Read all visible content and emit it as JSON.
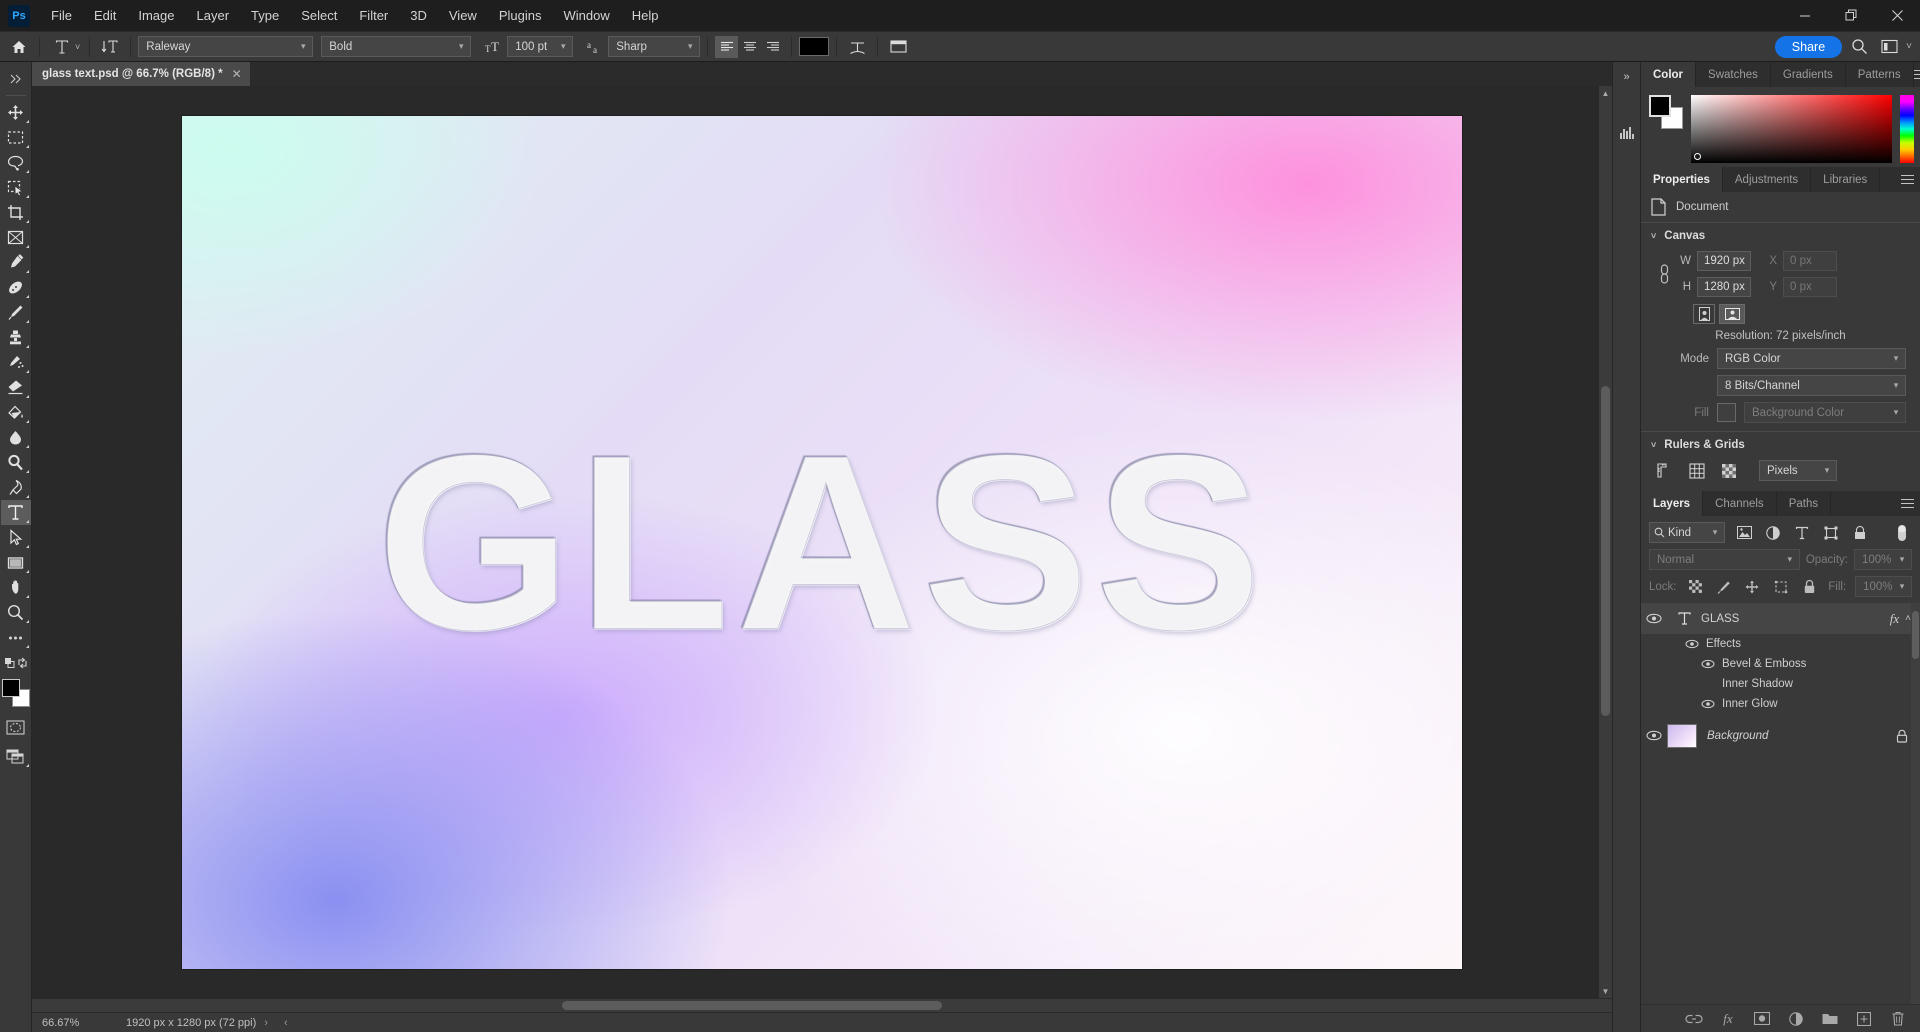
{
  "app": {
    "name": "Adobe Photoshop",
    "logo_text": "Ps"
  },
  "menubar": {
    "items": [
      {
        "label": "File"
      },
      {
        "label": "Edit"
      },
      {
        "label": "Image"
      },
      {
        "label": "Layer"
      },
      {
        "label": "Type"
      },
      {
        "label": "Select"
      },
      {
        "label": "Filter"
      },
      {
        "label": "3D"
      },
      {
        "label": "View"
      },
      {
        "label": "Plugins"
      },
      {
        "label": "Window"
      },
      {
        "label": "Help"
      }
    ],
    "window_controls": {
      "minimize": "—",
      "restore": "❐",
      "close": "✕"
    }
  },
  "options_bar": {
    "home_icon": "home-icon",
    "tool_icon": "type-tool-icon",
    "tool_caret": "˅",
    "orientation_icon": "text-orientation-icon",
    "font_family": "Raleway",
    "font_style": "Bold",
    "size_icon": "font-size-icon",
    "font_size": "100 pt",
    "antialias_icon": "anti-alias-icon",
    "antialias": "Sharp",
    "align": [
      "align-left",
      "align-center",
      "align-right"
    ],
    "align_selected": "align-left",
    "text_color": "#000000",
    "warp_icon": "create-warped-text-icon",
    "panels_icon": "toggle-panels-icon",
    "share_label": "Share",
    "search_icon": "search-icon",
    "workspace_icon": "workspace-icon",
    "workspace_caret": "˅",
    "arrange_caret": "»"
  },
  "toolbar": {
    "tools": [
      {
        "name": "move-tool",
        "glyph": "move"
      },
      {
        "name": "rectangular-marquee-tool",
        "glyph": "marquee"
      },
      {
        "name": "lasso-tool",
        "glyph": "lasso"
      },
      {
        "name": "object-selection-tool",
        "glyph": "objsel"
      },
      {
        "name": "crop-tool",
        "glyph": "crop"
      },
      {
        "name": "frame-tool",
        "glyph": "frame"
      },
      {
        "name": "eyedropper-tool",
        "glyph": "eyedropper"
      },
      {
        "name": "spot-healing-brush-tool",
        "glyph": "heal"
      },
      {
        "name": "brush-tool",
        "glyph": "brush"
      },
      {
        "name": "clone-stamp-tool",
        "glyph": "stamp"
      },
      {
        "name": "history-brush-tool",
        "glyph": "historybrush"
      },
      {
        "name": "eraser-tool",
        "glyph": "eraser"
      },
      {
        "name": "gradient-tool",
        "glyph": "bucket"
      },
      {
        "name": "blur-tool",
        "glyph": "blur"
      },
      {
        "name": "dodge-tool",
        "glyph": "dodge"
      },
      {
        "name": "pen-tool",
        "glyph": "pen"
      },
      {
        "name": "horizontal-type-tool",
        "glyph": "type",
        "active": true
      },
      {
        "name": "path-selection-tool",
        "glyph": "pathsel"
      },
      {
        "name": "rectangle-tool",
        "glyph": "rect"
      },
      {
        "name": "hand-tool",
        "glyph": "hand"
      },
      {
        "name": "zoom-tool",
        "glyph": "zoom"
      },
      {
        "name": "edit-toolbar-tool",
        "glyph": "dots"
      },
      {
        "name": "default-colors-tool",
        "glyph": "defaults"
      }
    ],
    "foreground_color": "#000000",
    "background_color": "#ffffff",
    "quick_mask_icon": "quick-mask-icon",
    "screen_mode_icon": "screen-mode-icon"
  },
  "document": {
    "tab_title": "glass text.psd @ 66.7% (RGB/8) *",
    "close_glyph": "✕",
    "canvas_text": "GLASS"
  },
  "status_bar": {
    "zoom": "66.67%",
    "dimensions": "1920 px x 1280 px (72 ppi)",
    "chevron_right": "›",
    "chevron_left": "‹"
  },
  "color_panel": {
    "tabs": [
      {
        "label": "Color",
        "active": true
      },
      {
        "label": "Swatches",
        "active": false
      },
      {
        "label": "Gradients",
        "active": false
      },
      {
        "label": "Patterns",
        "active": false
      }
    ],
    "foreground_color": "#000000",
    "background_color": "#ffffff",
    "menu_icon": "panel-menu-icon"
  },
  "properties_panel": {
    "tabs": [
      {
        "label": "Properties",
        "active": true
      },
      {
        "label": "Adjustments",
        "active": false
      },
      {
        "label": "Libraries",
        "active": false
      }
    ],
    "doc_icon": "document-icon",
    "doc_label": "Document",
    "canvas_section": {
      "title": "Canvas",
      "caret": "˅",
      "link_icon": "link-dimensions-icon",
      "w_label": "W",
      "w_value": "1920 px",
      "h_label": "H",
      "h_value": "1280 px",
      "x_label": "X",
      "x_value": "0 px",
      "y_label": "Y",
      "y_value": "0 px",
      "portrait_icon": "portrait-orientation-icon",
      "landscape_icon": "landscape-orientation-icon",
      "resolution": "Resolution: 72 pixels/inch",
      "mode_label": "Mode",
      "mode_value": "RGB Color",
      "depth_value": "8 Bits/Channel",
      "fill_label": "Fill",
      "fill_swatch": "#3f3f3f",
      "fill_value": "Background Color"
    },
    "rulers_section": {
      "title": "Rulers & Grids",
      "caret": "˅",
      "ruler_icon": "rulers-icon",
      "grid_icon": "grid-icon",
      "transparency_icon": "transparency-grid-icon",
      "units_value": "Pixels"
    }
  },
  "layers_panel": {
    "tabs": [
      {
        "label": "Layers",
        "active": true
      },
      {
        "label": "Channels",
        "active": false
      },
      {
        "label": "Paths",
        "active": false
      }
    ],
    "filter": {
      "search_icon": "search-icon",
      "kind_label": "Kind",
      "caret": "˅",
      "icons": [
        "pixel-layers-filter-icon",
        "adjustment-layers-filter-icon",
        "type-layers-filter-icon",
        "shape-layers-filter-icon",
        "smart-object-filter-icon"
      ],
      "toggle_icon": "filter-toggle-icon"
    },
    "blend_mode": "Normal",
    "opacity_label": "Opacity:",
    "opacity_value": "100%",
    "lock_label": "Lock:",
    "lock_icons": [
      "lock-transparent-pixels-icon",
      "lock-image-pixels-icon",
      "lock-position-icon",
      "lock-artboard-icon",
      "lock-all-icon"
    ],
    "fill_label": "Fill:",
    "fill_value": "100%",
    "layers": [
      {
        "name": "GLASS",
        "type_icon": "type-layer-icon",
        "visible_icon": "eye-icon",
        "fx_label": "fx",
        "expand_caret": "˄",
        "selected": true,
        "effects_label": "Effects",
        "effects": [
          {
            "name": "Bevel & Emboss",
            "visible": true
          },
          {
            "name": "Inner Shadow",
            "visible": false
          },
          {
            "name": "Inner Glow",
            "visible": true
          }
        ]
      },
      {
        "name": "Background",
        "visible_icon": "eye-icon",
        "lock_icon": "lock-icon",
        "selected": false
      }
    ],
    "footer_icons": [
      "link-layers-icon",
      "add-layer-style-icon",
      "add-layer-mask-icon",
      "new-fill-adjustment-layer-icon",
      "new-group-icon",
      "new-layer-icon",
      "delete-layer-icon"
    ],
    "footer_fx_label": "fx"
  }
}
